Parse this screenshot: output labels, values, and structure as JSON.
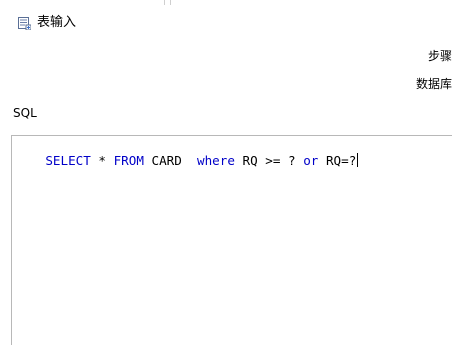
{
  "window": {
    "title": "表输入",
    "icon": "table-input-icon"
  },
  "labels": {
    "step": "步骤",
    "database": "数据库"
  },
  "sql": {
    "label": "SQL",
    "tokens": [
      {
        "text": "SELECT",
        "type": "keyword"
      },
      {
        "text": " * ",
        "type": "text"
      },
      {
        "text": "FROM",
        "type": "keyword"
      },
      {
        "text": " CARD  ",
        "type": "text"
      },
      {
        "text": "where",
        "type": "keyword"
      },
      {
        "text": " RQ >= ? ",
        "type": "text"
      },
      {
        "text": "or",
        "type": "keyword"
      },
      {
        "text": " RQ=?",
        "type": "text"
      }
    ]
  },
  "colors": {
    "keyword": "#0000c8",
    "text": "#000000",
    "border": "#b8b8b8"
  }
}
